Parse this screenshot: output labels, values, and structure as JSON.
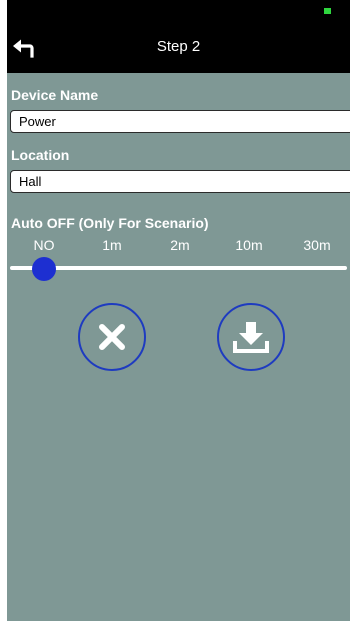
{
  "status_bar": {
    "battery_color": "#2fd63f"
  },
  "header": {
    "title": "Step 2",
    "back_icon": "back-arrow-icon"
  },
  "form": {
    "device_name": {
      "label": "Device Name",
      "value": "Power"
    },
    "location": {
      "label": "Location",
      "value": "Hall"
    }
  },
  "auto_off": {
    "label": "Auto OFF (Only For Scenario)",
    "options": [
      "NO",
      "1m",
      "2m",
      "10m",
      "30m"
    ],
    "selected": "NO",
    "selected_index": 0,
    "thumb_color": "#1d2fd1"
  },
  "actions": {
    "cancel_icon": "close-icon",
    "save_icon": "download-icon",
    "ring_color": "#1e3bc0"
  },
  "colors": {
    "background": "#7f9895",
    "header": "#000000",
    "text": "#ffffff"
  }
}
